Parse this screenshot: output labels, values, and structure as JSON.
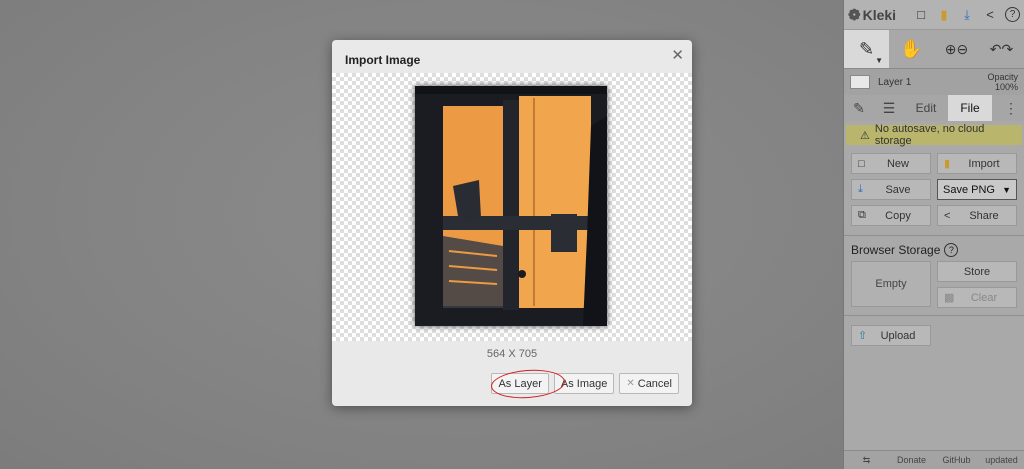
{
  "app": {
    "name": "Kleki",
    "topbar_icons": [
      "new-file-icon",
      "folder-icon",
      "download-icon",
      "share-icon",
      "help-icon"
    ]
  },
  "toolbar": {
    "tools": [
      "brush-icon",
      "hand-icon",
      "zoom-icon",
      "undo-redo-icon"
    ]
  },
  "layer": {
    "name": "Layer 1",
    "opacity_label": "Opacity",
    "opacity_value": "100%"
  },
  "tabs": {
    "edit": "Edit",
    "file": "File",
    "active": "File"
  },
  "file_panel": {
    "warning": "No autosave, no cloud storage",
    "new": "New",
    "import": "Import",
    "save": "Save",
    "save_format": "Save PNG",
    "copy": "Copy",
    "share": "Share",
    "browser_storage": "Browser Storage",
    "empty": "Empty",
    "store": "Store",
    "clear": "Clear",
    "upload": "Upload"
  },
  "footer": {
    "donate": "Donate",
    "github": "GitHub",
    "updated": "updated"
  },
  "dialog": {
    "title": "Import Image",
    "dimensions": "564 X 705",
    "as_layer": "As Layer",
    "as_image": "As Image",
    "cancel": "Cancel"
  },
  "colors": {
    "accent_warning": "#b9b56c",
    "annotation_circle": "#cf2020",
    "photo_orange": "#f0a24a"
  }
}
